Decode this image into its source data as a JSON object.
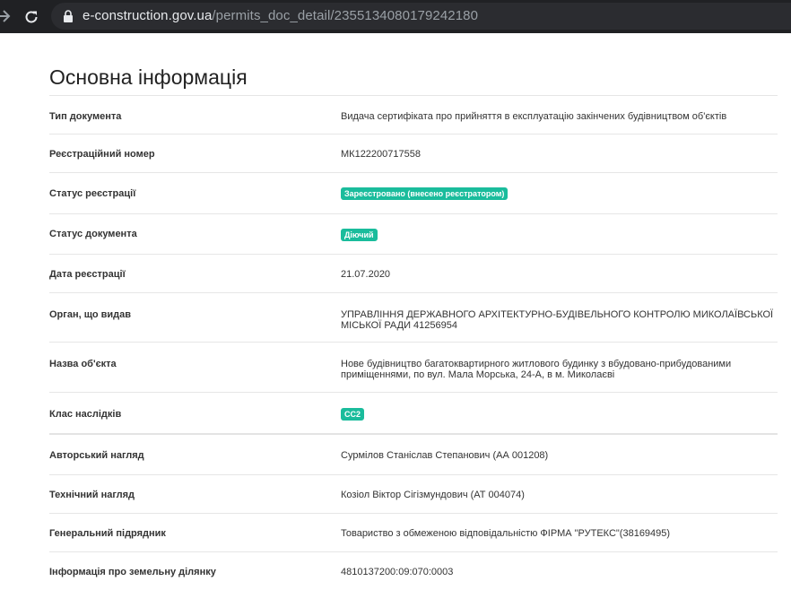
{
  "browser": {
    "url_host": "e-construction.gov.ua",
    "url_path": "/permits_doc_detail/2355134080179242180"
  },
  "page": {
    "title": "Основна інформація"
  },
  "rows": [
    {
      "label": "Тип документа",
      "value": "Видача сертифіката про прийняття в експлуатацію закінчених будівництвом об'єктів"
    },
    {
      "label": "Реєстраційний номер",
      "value": "МК122200717558"
    },
    {
      "label": "Статус реєстрації",
      "badge": "Зареєстровано (внесено реєстратором)"
    },
    {
      "label": "Статус документа",
      "badge": "Діючий"
    },
    {
      "label": "Дата реєстрації",
      "value": "21.07.2020"
    },
    {
      "label": "Орган, що видав",
      "value": "УПРАВЛІННЯ ДЕРЖАВНОГО АРХІТЕКТУРНО-БУДІВЕЛЬНОГО КОНТРОЛЮ МИКОЛАЇВСЬКОЇ МІСЬКОЇ РАДИ 41256954"
    },
    {
      "label": "Назва об'єкта",
      "value": "Нове будівництво багатоквартирного житлового будинку з вбудовано-прибудованими приміщеннями, по вул. Мала Морська, 24-А, в м. Миколаєві"
    },
    {
      "label": "Клас наслідків",
      "badge": "СС2"
    },
    {
      "label": "Авторський нагляд",
      "value": "Сурмілов Станіслав Степанович (АА 001208)"
    },
    {
      "label": "Технічний нагляд",
      "value": "Козіол Віктор Сігізмундович (АТ 004074)"
    },
    {
      "label": "Генеральний підрядник",
      "value": "Товариство з обмеженою відповідальністю ФІРМА \"РУТЕКС\"(38169495)"
    },
    {
      "label": "Інформація про земельну ділянку",
      "value": "4810137200:09:070:0003"
    }
  ],
  "colors": {
    "badge": "#1abc9c",
    "chrome_bg": "#202124"
  },
  "icons": [
    "back-arrow-icon",
    "reload-icon",
    "lock-icon"
  ]
}
